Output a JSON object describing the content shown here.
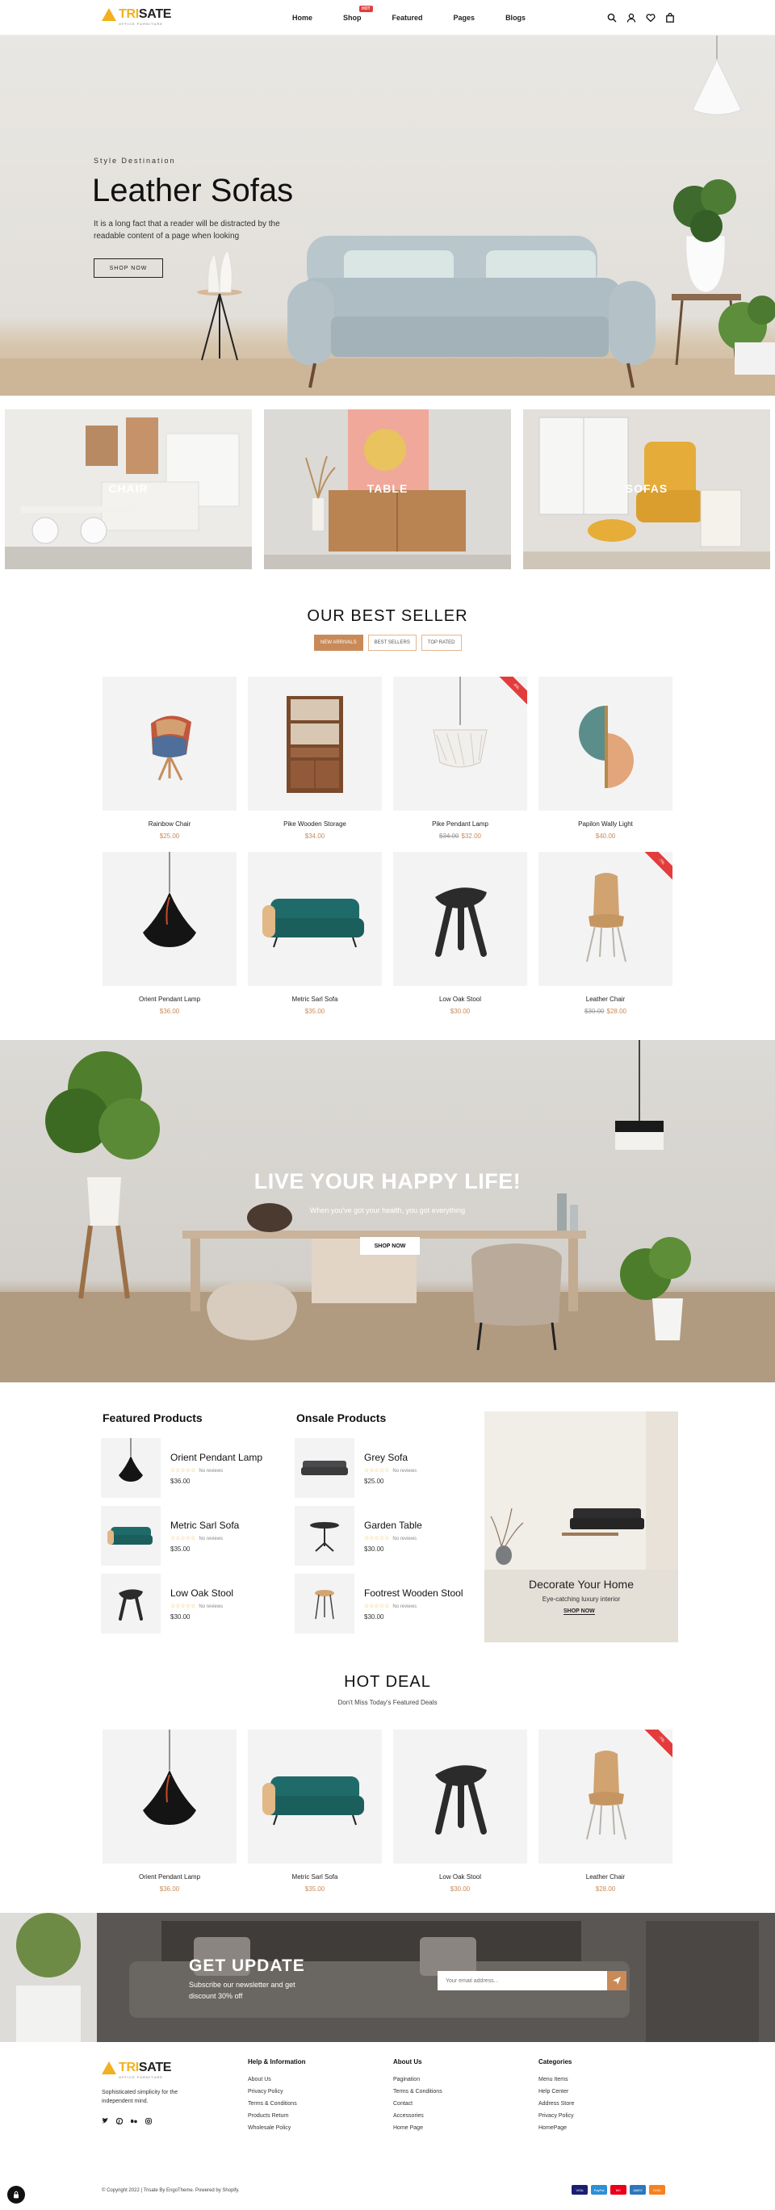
{
  "header": {
    "logo": {
      "tri": "TRI",
      "rest": "SATE",
      "tagline": "OFFICE FURNITURE"
    },
    "nav": [
      {
        "label": "Home"
      },
      {
        "label": "Shop",
        "badge": "HOT"
      },
      {
        "label": "Featured"
      },
      {
        "label": "Pages"
      },
      {
        "label": "Blogs"
      }
    ],
    "icons": [
      "search-icon",
      "user-icon",
      "heart-icon",
      "bag-icon"
    ]
  },
  "hero": {
    "kicker": "Style Destination",
    "title": "Leather Sofas",
    "description": "It is a long fact that a reader will be distracted by the readable content of a page when looking",
    "button": "SHOP NOW"
  },
  "categories": [
    {
      "label": "CHAIR"
    },
    {
      "label": "TABLE"
    },
    {
      "label": "SOFAS"
    }
  ],
  "best_seller": {
    "title": "OUR BEST SELLER",
    "tabs": [
      "NEW ARRIVALS",
      "BEST SELLERS",
      "TOP RATED"
    ],
    "products": [
      {
        "name": "Rainbow Chair",
        "price": "$25.00",
        "old_price": "",
        "sale": ""
      },
      {
        "name": "Pike Wooden Storage",
        "price": "$34.00",
        "old_price": "",
        "sale": ""
      },
      {
        "name": "Pike Pendant Lamp",
        "price": "$32.00",
        "old_price": "$34.00",
        "sale": "-6%"
      },
      {
        "name": "Papilon Wally Light",
        "price": "$40.00",
        "old_price": "",
        "sale": ""
      },
      {
        "name": "Orient Pendant Lamp",
        "price": "$36.00",
        "old_price": "",
        "sale": ""
      },
      {
        "name": "Metric Sarl Sofa",
        "price": "$35.00",
        "old_price": "",
        "sale": ""
      },
      {
        "name": "Low Oak Stool",
        "price": "$30.00",
        "old_price": "",
        "sale": ""
      },
      {
        "name": "Leather Chair",
        "price": "$28.00",
        "old_price": "$30.00",
        "sale": "-7%"
      }
    ]
  },
  "banner": {
    "title": "LIVE YOUR HAPPY LIFE!",
    "subtitle": "When you've got your health, you got everything",
    "button": "SHOP NOW"
  },
  "featured": {
    "title": "Featured Products",
    "items": [
      {
        "name": "Orient Pendant Lamp",
        "stars": "☆☆☆☆☆",
        "reviews": "No reviews",
        "price": "$36.00"
      },
      {
        "name": "Metric Sarl Sofa",
        "stars": "☆☆☆☆☆",
        "reviews": "No reviews",
        "price": "$35.00"
      },
      {
        "name": "Low Oak Stool",
        "stars": "☆☆☆☆☆",
        "reviews": "No reviews",
        "price": "$30.00"
      }
    ]
  },
  "onsale": {
    "title": "Onsale Products",
    "items": [
      {
        "name": "Grey Sofa",
        "stars": "☆☆☆☆☆",
        "reviews": "No reviews",
        "price": "$25.00"
      },
      {
        "name": "Garden Table",
        "stars": "☆☆☆☆☆",
        "reviews": "No reviews",
        "price": "$30.00"
      },
      {
        "name": "Footrest Wooden Stool",
        "stars": "☆☆☆☆☆",
        "reviews": "No reviews",
        "price": "$30.00"
      }
    ]
  },
  "promo": {
    "title": "Decorate Your Home",
    "subtitle": "Eye-catching luxury interior",
    "button": "SHOP NOW"
  },
  "hot_deal": {
    "title": "HOT DEAL",
    "subtitle": "Don't Miss Today's Featured Deals",
    "products": [
      {
        "name": "Orient Pendant Lamp",
        "price": "$36.00",
        "sale": ""
      },
      {
        "name": "Metric Sarl Sofa",
        "price": "$35.00",
        "sale": ""
      },
      {
        "name": "Low Oak Stool",
        "price": "$30.00",
        "sale": ""
      },
      {
        "name": "Leather Chair",
        "price": "$28.00",
        "old_price": "$30.00",
        "sale": "-7%"
      }
    ]
  },
  "newsletter": {
    "title": "GET UPDATE",
    "subtitle": "Subscribe our newsletter and get discount 30% off",
    "placeholder": "Your email address..."
  },
  "footer": {
    "description": "Sophisticated simplicity for the independent mind.",
    "social": [
      "twitter-icon",
      "pinterest-icon",
      "behance-icon",
      "instagram-icon"
    ],
    "columns": [
      {
        "title": "Help & Information",
        "links": [
          "About Us",
          "Privacy Policy",
          "Terms & Conditions",
          "Products Return",
          "Wholesale Policy"
        ]
      },
      {
        "title": "About Us",
        "links": [
          "Pagination",
          "Terms & Conditions",
          "Contact",
          "Accessories",
          "Home Page"
        ]
      },
      {
        "title": "Categories",
        "links": [
          "Menu Items",
          "Help Center",
          "Address Store",
          "Privacy Policy",
          "HomePage"
        ]
      }
    ],
    "copyright": "© Copyright 2022 | Trisate By EngoTheme. Powered by Shopify.",
    "payments": [
      {
        "label": "VISA",
        "color": "#1a1f71"
      },
      {
        "label": "PayPal",
        "color": "#2d8fd5"
      },
      {
        "label": "MC",
        "color": "#eb001b"
      },
      {
        "label": "AMEX",
        "color": "#2e77bc"
      },
      {
        "label": "DISC",
        "color": "#f58220"
      }
    ]
  }
}
